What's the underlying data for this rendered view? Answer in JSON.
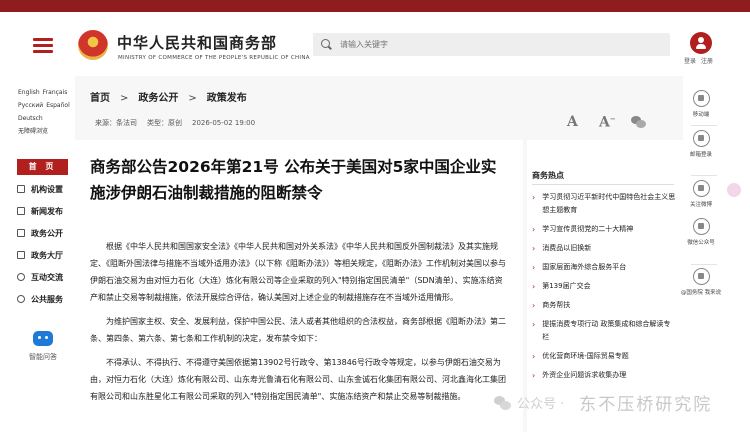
{
  "header": {
    "site_title": "中华人民共和国商务部",
    "site_subtitle": "MINISTRY OF COMMERCE OF THE PEOPLE'S REPUBLIC OF CHINA",
    "search_placeholder": "请输入关键字",
    "login": "登录",
    "register": "注册",
    "brand_color": "#b1201f"
  },
  "languages": {
    "row1": [
      "English",
      "Français"
    ],
    "row2": [
      "Русский",
      "Español"
    ],
    "row3": [
      "Deutsch"
    ],
    "row4": [
      "无障碍浏览"
    ]
  },
  "sidebar": {
    "home": "首 页",
    "items": [
      {
        "label": "机构设置",
        "icon": "building-icon"
      },
      {
        "label": "新闻发布",
        "icon": "news-icon"
      },
      {
        "label": "政务公开",
        "icon": "document-icon"
      },
      {
        "label": "政务大厅",
        "icon": "hall-icon"
      },
      {
        "label": "互动交流",
        "icon": "chat-icon"
      },
      {
        "label": "公共服务",
        "icon": "service-icon"
      }
    ],
    "robot_label": "智能问答"
  },
  "breadcrumb": [
    "首页",
    "政务公开",
    "政策发布"
  ],
  "meta": {
    "source": "来源：条法司",
    "type": "类型：原创",
    "date": "2026-05-02 19:00"
  },
  "font_controls": {
    "increase": "A",
    "decrease": "A"
  },
  "article": {
    "title": "商务部公告2026年第21号 公布关于美国对5家中国企业实施涉伊朗石油制裁措施的阻断禁令",
    "paragraphs": [
      "根据《中华人民共和国国家安全法》《中华人民共和国对外关系法》《中华人民共和国反外国制裁法》及其实施规定、《阻断外国法律与措施不当域外适用办法》（以下称《阻断办法》）等相关规定，《阻断办法》工作机制对美国以参与伊朗石油交易为由对恒力石化（大连）炼化有限公司等企业采取的列入\"特别指定国民清单\"（SDN清单）、实施冻结资产和禁止交易等制裁措施，依法开展综合评估，确认美国对上述企业的制裁措施存在不当域外适用情形。",
      "为维护国家主权、安全、发展利益，保护中国公民、法人或者其他组织的合法权益，商务部根据《阻断办法》第二条、第四条、第六条、第七条和工作机制的决定，发布禁令如下：",
      "不得承认、不得执行、不得遵守美国依据第13902号行政令、第13846号行政令等规定，以参与伊朗石油交易为由，对恒力石化（大连）炼化有限公司、山东寿光鲁清石化有限公司、山东金诚石化集团有限公司、河北鑫海化工集团有限公司和山东胜星化工有限公司采取的列入\"特别指定国民清单\"、实施冻结资产和禁止交易等制裁措施。"
    ]
  },
  "hot": {
    "title": "商务热点",
    "items": [
      "学习贯彻习近平新时代中国特色社会主义思想主题教育",
      "学习宣传贯彻党的二十大精神",
      "消费品以旧换新",
      "国家层面海外综合服务平台",
      "第139届广交会",
      "商务帮扶",
      "提振消费专项行动 政策集成和综合解读专栏",
      "优化营商环境-国际贸易专题",
      "外资企业问题诉求收集办理"
    ]
  },
  "util": {
    "items": [
      "移动端",
      "邮箱登录",
      "关注微博",
      "微信公众号",
      "@国务院 我来说"
    ]
  },
  "watermark": {
    "sub": "公众号 ·",
    "main": "东不压桥研究院"
  }
}
